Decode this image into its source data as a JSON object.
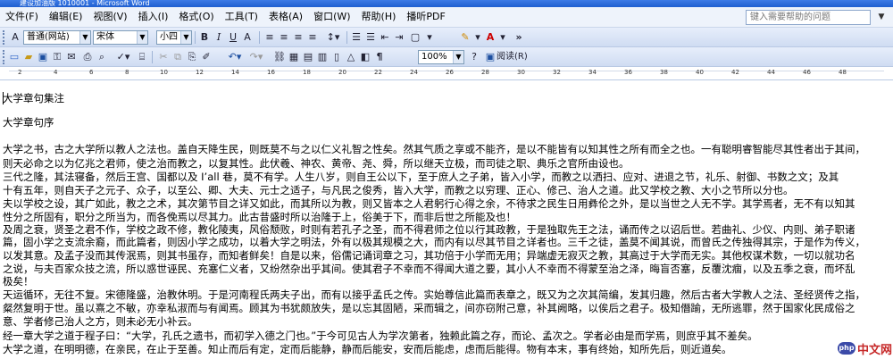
{
  "window": {
    "title": "建设加油版 1010001 - Microsoft Word"
  },
  "menu": {
    "items": [
      "文件(F)",
      "编辑(E)",
      "视图(V)",
      "插入(I)",
      "格式(O)",
      "工具(T)",
      "表格(A)",
      "窗口(W)",
      "帮助(H)",
      "播听PDF"
    ],
    "help_placeholder": "键入需要帮助的问题",
    "help_arrow": "▼"
  },
  "toolbar1": {
    "style": "普通(网站)",
    "font": "宋体",
    "size": "小四",
    "bold": "B",
    "italic": "I",
    "underline": "U",
    "char_a": "A",
    "arrow": "▼"
  },
  "toolbar2": {
    "zoom": "100%",
    "read": "阅读(R)"
  },
  "ruler": {
    "numbers": [
      "2",
      "4",
      "6",
      "8",
      "10",
      "12",
      "14",
      "16",
      "18",
      "20",
      "22",
      "24",
      "26",
      "28",
      "30",
      "32",
      "34",
      "36",
      "38",
      "40",
      "42",
      "44",
      "46",
      "48"
    ]
  },
  "document": {
    "lines": [
      "大学章句集注",
      "大学章句序",
      "大学之书，古之大学所以教人之法也。盖自天降生民，则既莫不与之以仁义礼智之性矣。然其气质之享或不能齐，是以不能皆有以知其性之所有而全之也。一有聪明睿智能尽其性者出于其间，",
      "则天必命之以为亿兆之君师，使之治而教之，以复其性。此伏羲、神农、黄帝、尧、舜，所以继天立极，而司徒之职、典乐之官所由设也。",
      "三代之隆，其法寝备，然后王宫、国都以及 I’all 巷，莫不有学。人生八岁，则自王公以下，至于庶人之子弟，皆入小学，而教之以洒扫、应对、进退之节，礼乐、射御、书数之文；及其",
      "十有五年，则自天子之元子、众子，以至公、卿、大夫、元士之适子，与凡民之俊秀，皆入大学，而教之以穷理、正心、修己、治人之道。此又学校之教、大小之节所以分也。",
      "夫以学校之设，其广如此，教之之术，其次第节目之详又如此，而其所以为教，则又皆本之人君躬行心得之余，不待求之民生日用彝伦之外，是以当世之人无不学。其学焉者，无不有以知其",
      "性分之所固有，职分之所当为，而各俛焉以尽其力。此古昔盛时所以治隆于上，俗美于下，而非后世之所能及也！",
      "及周之衰，贤圣之君不作，学校之政不修，教化陵夷，风俗颓败，时则有若孔子之圣，而不得君师之位以行其政教，于是独取先王之法，诵而传之以诏后世。若曲礼、少仪、内则、弟子职诸",
      "篇，固小学之支流余裔，而此篇者，则因小学之成功，以着大学之明法，外有以极其规模之大，而内有以尽其节目之详者也。三千之徒，盖莫不闻其说，而曾氏之传独得其宗，于是作为传义，",
      "以发其意。及孟子没而其传泯焉，则其书虽存，而知者鲜矣！自是以来，俗儒记诵词章之习，其功倍于小学而无用；异端虚无寂灭之教，其高过于大学而无实。其他权谋术数，一切以就功名",
      "之说，与夫百家众技之流，所以惑世诬民、充塞仁义者，又纷然杂出乎其间。使其君子不幸而不得闻大道之要，其小人不幸而不得蒙至治之泽，晦盲否塞，反覆沈痼，以及五季之衰，而坏乱",
      "极矣！",
      "天运循环，无往不复。宋德隆盛，治教休明。于是河南程氏两夫子出，而有以接乎孟氏之传。实始尊信此篇而表章之，既又为之次其简编，发其归趣，然后古者大学教人之法、圣经贤传之指，",
      "粲然复明于世。虽以熹之不敏，亦幸私淑而与有闻焉。顾其为书犹颇放失，是以忘其固陋，采而辑之，间亦窃附己意，补其阙略，以俟后之君子。极知僭踰，无所逃罪，然于国家化民成俗之",
      "意、学者修己治人之方，则未必无小补云。",
      "经一章大学之道于程子曰：“大学，孔氏之遗书，而初学入德之门也。”于今可见古人为学次第者，独赖此篇之存，而论、孟次之。学者必由是而学焉，则庶乎其不差矣。",
      "大学之道，在明明德，在亲民，在止于至善。知止而后有定，定而后能静，静而后能安，安而后能虑，虑而后能得。物有本末，事有终始，知所先后，则近道矣。"
    ]
  },
  "watermark": {
    "logo": "php",
    "text": "中文网"
  }
}
